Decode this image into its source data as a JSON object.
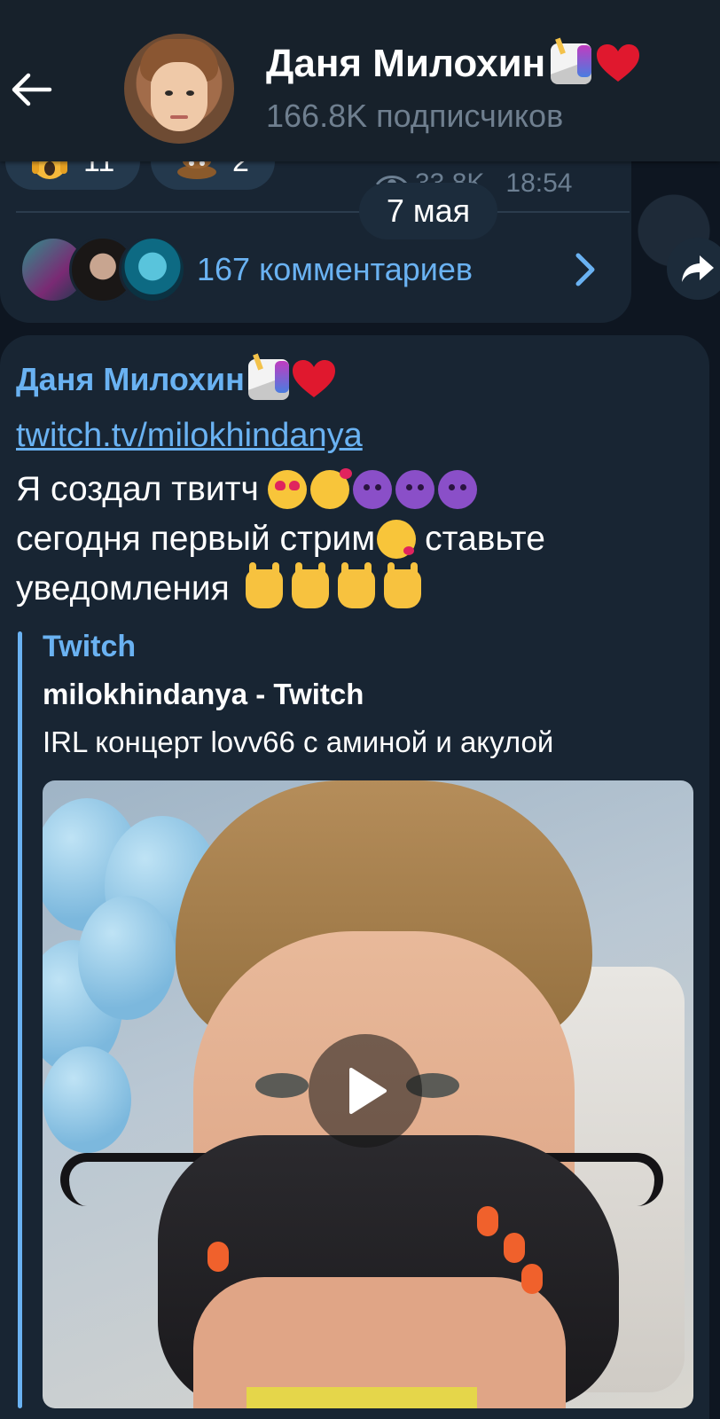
{
  "header": {
    "back_icon": "arrow-left-icon",
    "channel_name": "Даня Милохин",
    "title_emojis": [
      "unicorn-emoji",
      "red-heart-emoji"
    ],
    "subscribers": "166.8K подписчиков"
  },
  "previous_post": {
    "reactions": [
      {
        "emoji": "screaming-face-emoji",
        "count": "11"
      },
      {
        "emoji": "pile-of-poo-emoji",
        "count": "2"
      }
    ],
    "views": "33.8K",
    "time": "18:54",
    "comments_label": "167 комментариев"
  },
  "date_separator": "7 мая",
  "post": {
    "author": "Даня Милохин",
    "link": "twitch.tv/milokhindanya",
    "lines": [
      "Я создал твитч",
      "сегодня первый стрим",
      "ставьте",
      "уведомления"
    ],
    "preview": {
      "site": "Twitch",
      "title": "milokhindanya - Twitch",
      "description": "IRL концерт lovv66 с аминой и акулой"
    }
  },
  "colors": {
    "background": "#0e1621",
    "header": "#17212b",
    "bubble": "#182533",
    "accent": "#6ab2f2",
    "muted": "#6f7f8f"
  }
}
